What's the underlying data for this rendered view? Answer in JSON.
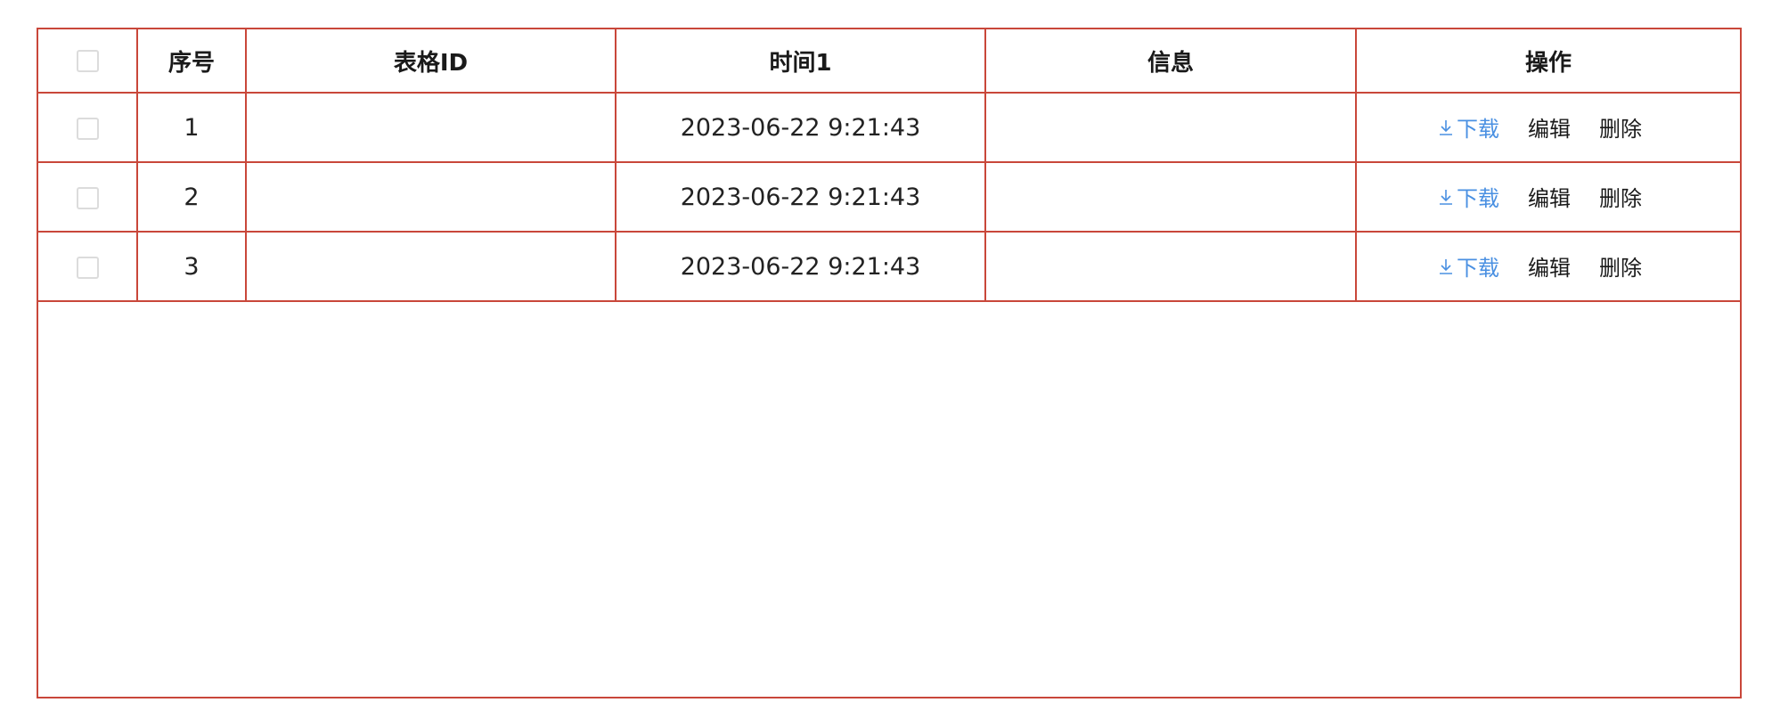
{
  "table": {
    "headers": {
      "select_all": "",
      "index": "序号",
      "table_id": "表格ID",
      "time1": "时间1",
      "info": "信息",
      "actions": "操作"
    },
    "rows": [
      {
        "index": "1",
        "table_id": "",
        "time1": "2023-06-22 9:21:43",
        "info": ""
      },
      {
        "index": "2",
        "table_id": "",
        "time1": "2023-06-22 9:21:43",
        "info": ""
      },
      {
        "index": "3",
        "table_id": "",
        "time1": "2023-06-22 9:21:43",
        "info": ""
      }
    ],
    "actions": {
      "download_label": "下载",
      "edit_label": "编辑",
      "delete_label": "删除",
      "download_icon": "download-icon"
    }
  },
  "colors": {
    "border": "#c9473a",
    "link": "#4a90e2",
    "checkbox_border": "#dcdcdc"
  }
}
